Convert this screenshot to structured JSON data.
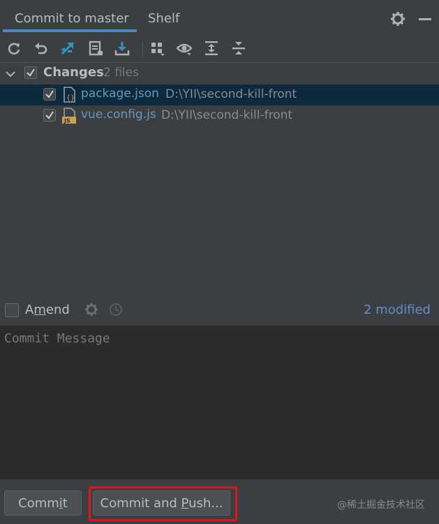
{
  "colors": {
    "background": "#3c3f41",
    "editor_bg": "#2b2b2b",
    "selection": "#0d293e",
    "accent": "#4a88c7",
    "file_blue": "#6897bb",
    "highlight_red": "#e0141a"
  },
  "tabs": [
    {
      "label": "Commit to master",
      "active": true
    },
    {
      "label": "Shelf",
      "active": false
    }
  ],
  "tab_actions": [
    "gear-icon",
    "minimize-icon"
  ],
  "toolbar": [
    "refresh-icon",
    "rollback-icon",
    "diff-icon",
    "shelve-icon",
    "update-icon",
    "group-by-icon",
    "eye-icon",
    "expand-all-icon",
    "collapse-all-icon"
  ],
  "changes": {
    "label": "Changes",
    "count": "2 files",
    "checked": true,
    "files": [
      {
        "name": "package.json",
        "path": "D:\\YII\\second-kill-front",
        "icon": "json-file-icon",
        "checked": true,
        "selected": true
      },
      {
        "name": "vue.config.js",
        "path": "D:\\YII\\second-kill-front",
        "icon": "js-file-icon",
        "checked": true,
        "selected": false
      }
    ]
  },
  "amend": {
    "label_pre": "A",
    "label_underlined": "m",
    "label_post": "end",
    "checked": false
  },
  "status": {
    "modified": "2 modified"
  },
  "message": {
    "placeholder": "Commit Message",
    "value": ""
  },
  "buttons": {
    "commit_pre": "Comm",
    "commit_underlined": "i",
    "commit_post": "t",
    "push_pre": "Commit and ",
    "push_underlined": "P",
    "push_post": "ush..."
  },
  "watermark": "@稀土掘金技术社区"
}
